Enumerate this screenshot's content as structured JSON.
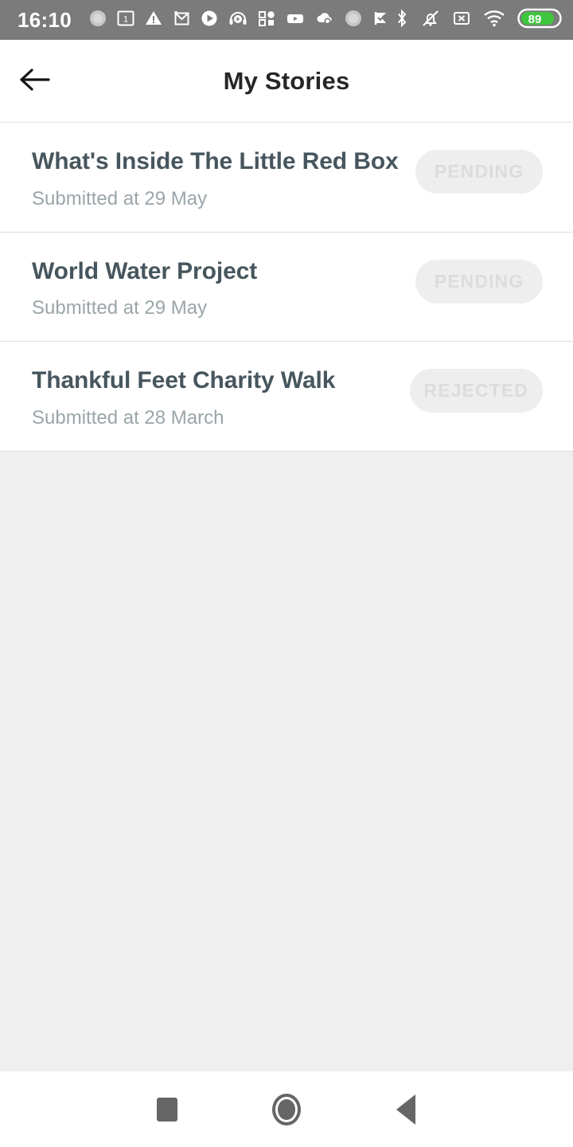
{
  "status_bar": {
    "time": "16:10",
    "battery_level": "89",
    "background_color": "#7b7b7b",
    "battery_color": "#3ec63e",
    "left_icons": [
      "gradient-circle-icon",
      "calendar-day-1-icon",
      "warning-triangle-icon",
      "gmail-icon",
      "play-store-icon",
      "headphones-play-icon",
      "apps-grid-icon",
      "youtube-icon",
      "cloud-sync-icon",
      "gradient-circle-icon-2",
      "check-flag-icon"
    ],
    "right_icons": [
      "bluetooth-icon",
      "mute-bell-icon",
      "sd-card-x-icon",
      "wifi-icon",
      "battery-icon"
    ]
  },
  "app_bar": {
    "back_label": "back-arrow",
    "title": "My Stories",
    "title_color": "#262626"
  },
  "theme": {
    "title_color": "#47565e",
    "subtitle_color": "#9aa5a9",
    "badge_bg": "#eeeeee",
    "badge_text": "#dcdcdc",
    "page_bg": "#efefef",
    "card_bg": "#ffffff",
    "divider": "#dedede"
  },
  "stories": [
    {
      "title": "What's Inside The Little Red Box",
      "submitted": "Submitted at 29 May",
      "status": "PENDING"
    },
    {
      "title": "World Water Project",
      "submitted": "Submitted at 29 May",
      "status": "PENDING"
    },
    {
      "title": "Thankful Feet Charity Walk",
      "submitted": "Submitted at 28 March",
      "status": "REJECTED"
    }
  ],
  "nav_bar": {
    "recents_label": "recents",
    "home_label": "home",
    "back_label": "back"
  }
}
